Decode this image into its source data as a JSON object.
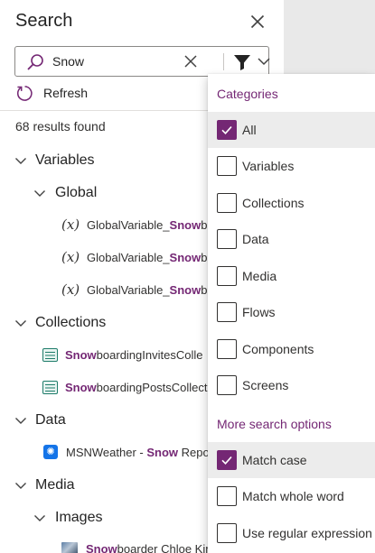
{
  "pane": {
    "title": "Search",
    "search_value": "Snow",
    "refresh_label": "Refresh",
    "results_count": "68 results found"
  },
  "tree": {
    "variables": "Variables",
    "global": "Global",
    "var1": {
      "pre": "GlobalVariable_",
      "hl": "Snow",
      "post": "b"
    },
    "var2": {
      "pre": "GlobalVariable_",
      "hl": "Snow",
      "post": "b"
    },
    "var3": {
      "pre": "GlobalVariable_",
      "hl": "Snow",
      "post": "b"
    },
    "collections": "Collections",
    "coll1": {
      "hl": "Snow",
      "post": "boardingInvitesColle"
    },
    "coll2": {
      "hl": "Snow",
      "post": "boardingPostsCollect"
    },
    "data": "Data",
    "data1": {
      "pre": "MSNWeather - ",
      "hl": "Snow",
      "post": " Repo"
    },
    "media": "Media",
    "images": "Images",
    "img1": {
      "hl": "Snow",
      "post": "boarder Chloe Kim with trop"
    }
  },
  "dropdown": {
    "categories_header": "Categories",
    "categories": [
      {
        "label": "All",
        "checked": true
      },
      {
        "label": "Variables",
        "checked": false
      },
      {
        "label": "Collections",
        "checked": false
      },
      {
        "label": "Data",
        "checked": false
      },
      {
        "label": "Media",
        "checked": false
      },
      {
        "label": "Flows",
        "checked": false
      },
      {
        "label": "Components",
        "checked": false
      },
      {
        "label": "Screens",
        "checked": false
      }
    ],
    "options_header": "More search options",
    "options": [
      {
        "label": "Match case",
        "checked": true
      },
      {
        "label": "Match whole word",
        "checked": false
      },
      {
        "label": "Use regular expression",
        "checked": false
      }
    ]
  },
  "colors": {
    "accent": "#742774",
    "selected_row": "#ececec",
    "canvas": "#e9e9e9"
  },
  "icons": {
    "close": "close-icon",
    "search": "search-icon",
    "clear": "clear-icon",
    "filter": "filter-icon",
    "refresh": "refresh-icon",
    "variable": "variable-icon",
    "collection": "collection-icon",
    "data_source": "msn-weather-icon"
  }
}
